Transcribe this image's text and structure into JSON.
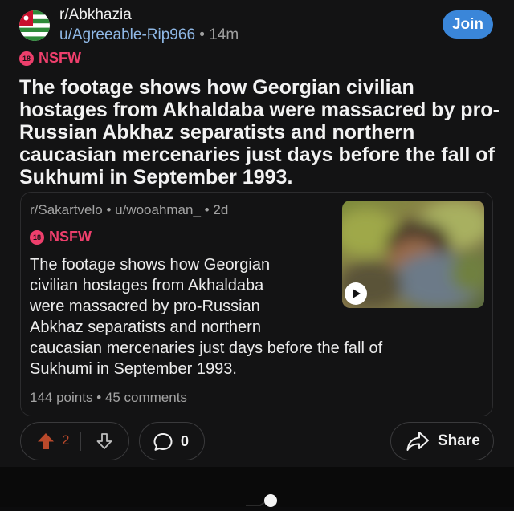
{
  "header": {
    "subreddit": "r/Abkhazia",
    "author": "u/Agreeable-Rip966",
    "separator": "•",
    "time": "14m",
    "join_label": "Join",
    "avatar_icon": "abkhazia-flag-icon"
  },
  "post": {
    "nsfw_badge": "18",
    "nsfw_label": "NSFW",
    "title": "The footage shows how Georgian civilian hostages from Akhaldaba were massacred by pro-Russian Abkhaz separatists and northern caucasian mercenaries just days before the fall of Sukhumi in September 1993."
  },
  "crosspost": {
    "subreddit": "r/Sakartvelo",
    "separator": "•",
    "author": "u/wooahman_",
    "time": "2d",
    "nsfw_badge": "18",
    "nsfw_label": "NSFW",
    "body_lines": [
      "The footage shows how Georgian",
      "civilian hostages from Akhaldaba",
      "were massacred by pro-Russian",
      "Abkhaz separatists and northern",
      "caucasian mercenaries just days before the fall of",
      "Sukhumi in September 1993."
    ],
    "points": "144 points",
    "comments": "45 comments",
    "video_icon": "play-icon"
  },
  "actions": {
    "upvote_count": "2",
    "comment_count": "0",
    "share_label": "Share"
  },
  "colors": {
    "accent_blue": "#3a86d9",
    "nsfw_pink": "#ee3f6c",
    "upvote_orange": "#b9492b",
    "background": "#131314"
  }
}
